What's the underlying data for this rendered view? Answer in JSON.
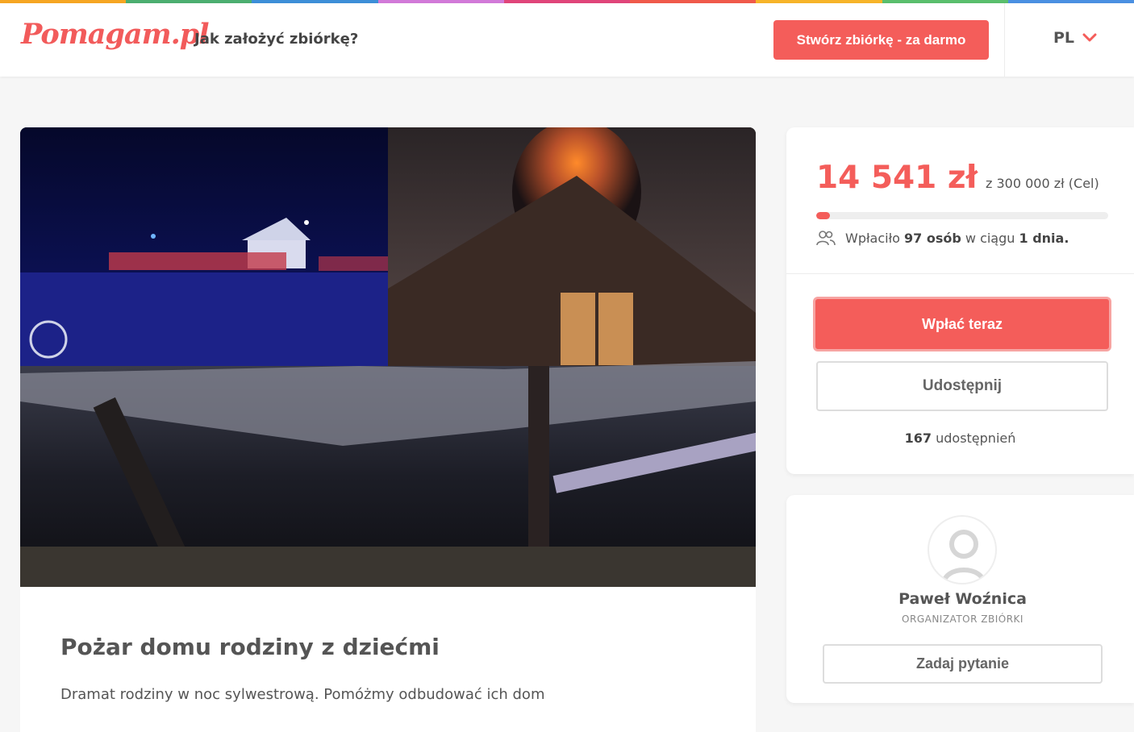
{
  "header": {
    "logo": "Pomagam.pl",
    "howto_link": "Jak założyć zbiórkę?",
    "create_button": "Stwórz zbiórkę - za darmo",
    "language": "PL"
  },
  "colors": {
    "accent": "#f45d5a",
    "rainbow": [
      "#f6a623",
      "#4caf70",
      "#3d8fd8",
      "#d27ad9",
      "#e0457a",
      "#f05a4b",
      "#f7b429",
      "#5abf6d",
      "#4a90e2"
    ]
  },
  "campaign": {
    "title": "Pożar domu rodziny z dziećmi",
    "subtitle": "Dramat rodziny w noc sylwestrową. Pomóżmy odbudować ich dom",
    "image_icon": "photo-collage"
  },
  "donation": {
    "amount": "14 541 zł",
    "goal": "z 300 000 zł (Cel)",
    "progress_fraction": 0.048,
    "donors_prefix": "Wpłaciło",
    "donors_count": "97 osób",
    "donors_mid": "w ciągu",
    "donors_period": "1 dnia.",
    "pay_button": "Wpłać teraz",
    "share_button": "Udostępnij",
    "share_count": "167",
    "share_label": "udostępnień"
  },
  "organizer": {
    "name": "Paweł Woźnica",
    "role": "ORGANIZATOR ZBIÓRKI",
    "ask_button": "Zadaj pytanie"
  }
}
